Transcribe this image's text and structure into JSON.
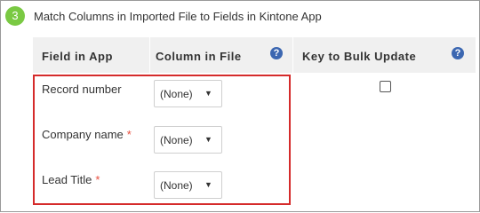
{
  "step": {
    "number": "3",
    "title": "Match Columns in Imported File to Fields in Kintone App"
  },
  "table": {
    "headers": {
      "field": "Field in App",
      "column": "Column in File",
      "key": "Key to Bulk Update"
    },
    "rows": [
      {
        "field": "Record number",
        "required": "",
        "column_value": "(None)"
      },
      {
        "field": "Company name",
        "required": "*",
        "column_value": "(None)"
      },
      {
        "field": "Lead Title",
        "required": "*",
        "column_value": "(None)"
      }
    ],
    "key_checkbox_checked": false
  },
  "icons": {
    "help": "question-icon",
    "caret": "dropdown-caret-icon"
  },
  "colors": {
    "step_badge": "#7ac943",
    "highlight_border": "#d52b2b",
    "required": "#e74c3c",
    "help_icon": "#3c67b1",
    "header_bg": "#f0f0f0"
  }
}
